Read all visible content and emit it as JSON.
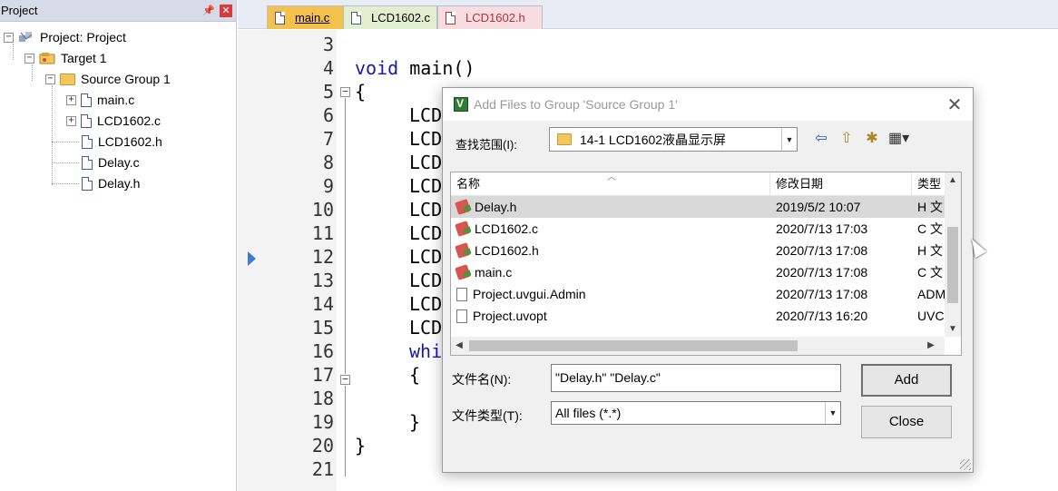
{
  "project_panel": {
    "title": "Project",
    "pin_glyph": "ᵖ",
    "close_glyph": "✕",
    "tree": [
      {
        "label": "Project: Project",
        "icon": "project-icon"
      },
      {
        "label": "Target 1",
        "icon": "target-icon"
      },
      {
        "label": "Source Group 1",
        "icon": "folder-icon"
      },
      {
        "label": "main.c",
        "icon": "file-icon"
      },
      {
        "label": "LCD1602.c",
        "icon": "file-icon"
      },
      {
        "label": "LCD1602.h",
        "icon": "file-icon"
      },
      {
        "label": "Delay.c",
        "icon": "file-icon"
      },
      {
        "label": "Delay.h",
        "icon": "file-icon"
      }
    ]
  },
  "tabs": [
    {
      "label": "main.c",
      "active": true
    },
    {
      "label": "LCD1602.c",
      "active": false
    },
    {
      "label": "LCD1602.h",
      "active": false
    }
  ],
  "editor": {
    "line_numbers": [
      "3",
      "4",
      "5",
      "6",
      "7",
      "8",
      "9",
      "10",
      "11",
      "12",
      "13",
      "14",
      "15",
      "16",
      "17",
      "18",
      "19",
      "20",
      "21"
    ],
    "lines": {
      "l4_kw": "void",
      "l4_rest": " main()",
      "l5": "{",
      "l6": "LCD",
      "l7": "LCD",
      "l8": "LCD",
      "l9": "LCD",
      "l10": "LCD",
      "l11": "LCD",
      "l12": "LCD",
      "l13": "LCD",
      "l14": "LCD",
      "l15": "LCD",
      "l16_kw": "whi",
      "l17": "{",
      "l19": "}",
      "l20": "}"
    }
  },
  "dialog": {
    "title": "Add Files to Group 'Source Group 1'",
    "close_glyph": "✕",
    "look_in_label": "查找范围(I):",
    "look_in_value": "14-1 LCD1602液晶显示屏",
    "columns": {
      "name": "名称",
      "date": "修改日期",
      "type": "类型"
    },
    "files": [
      {
        "name": "Delay.h",
        "date": "2019/5/2 10:07",
        "type": "H 文",
        "icon": "keil-file-icon",
        "selected": true
      },
      {
        "name": "LCD1602.c",
        "date": "2020/7/13 17:03",
        "type": "C 文",
        "icon": "keil-file-icon",
        "selected": false
      },
      {
        "name": "LCD1602.h",
        "date": "2020/7/13 17:08",
        "type": "H 文",
        "icon": "keil-file-icon",
        "selected": false
      },
      {
        "name": "main.c",
        "date": "2020/7/13 17:08",
        "type": "C 文",
        "icon": "keil-file-icon",
        "selected": false
      },
      {
        "name": "Project.uvgui.Admin",
        "date": "2020/7/13 17:08",
        "type": "ADM",
        "icon": "document-icon",
        "selected": false
      },
      {
        "name": "Project.uvopt",
        "date": "2020/7/13 16:20",
        "type": "UVC",
        "icon": "document-icon",
        "selected": false
      }
    ],
    "file_name_label": "文件名(N):",
    "file_name_value": "\"Delay.h\" \"Delay.c\"",
    "file_type_label": "文件类型(T):",
    "file_type_value": "All files (*.*)",
    "add_label": "Add",
    "close_label": "Close"
  },
  "colors": {
    "tab_active": "#f4c14c",
    "tab_c": "#e2efcf",
    "tab_h": "#f8dde0",
    "keyword": "#1919a6",
    "selected_row": "#d9d9d9"
  }
}
